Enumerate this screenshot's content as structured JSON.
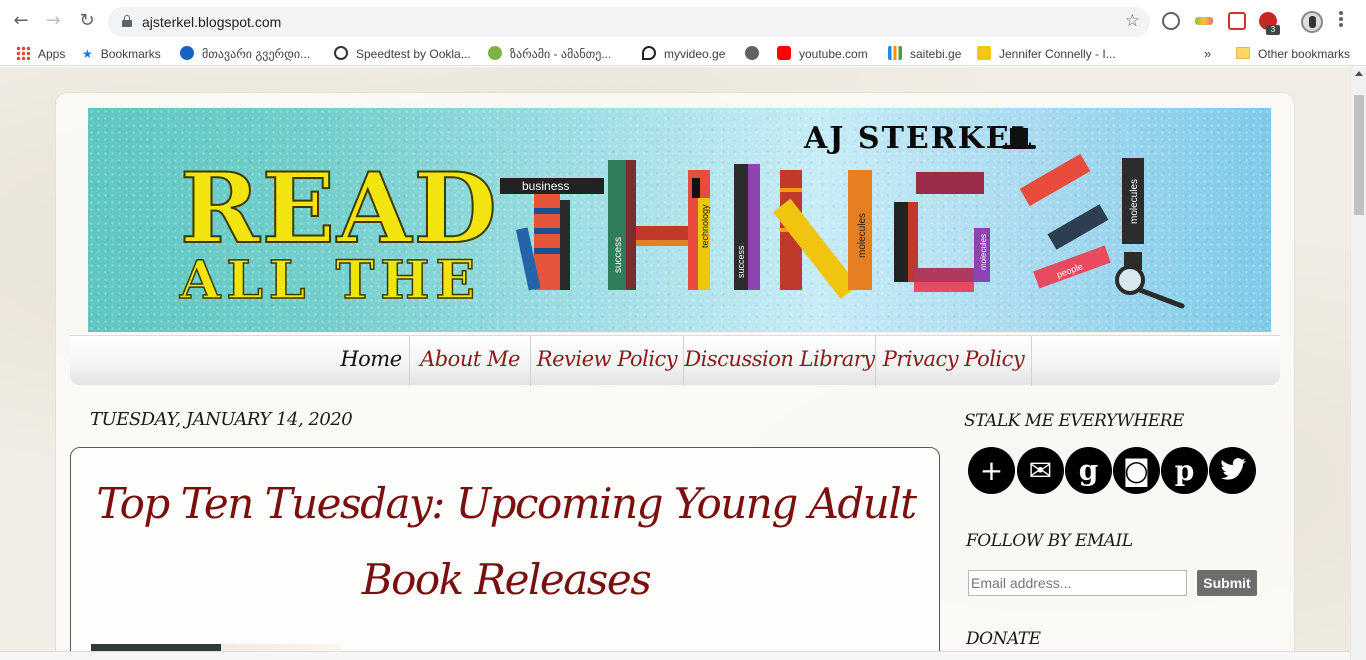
{
  "browser": {
    "url": "ajsterkel.blogspot.com",
    "extension_badge": "3",
    "bookmarks": [
      {
        "label": "Apps",
        "icon": "apps-grid-icon"
      },
      {
        "label": "Bookmarks",
        "icon": "star-icon"
      },
      {
        "label": "მთავარი გვერდი...",
        "icon": "net-icon"
      },
      {
        "label": "Speedtest by Ookla...",
        "icon": "speedtest-icon"
      },
      {
        "label": "ზარამი - ამანთე...",
        "icon": "globe-icon"
      },
      {
        "label": "myvideo.ge",
        "icon": "myvideo-icon"
      },
      {
        "label": "",
        "icon": "world-icon"
      },
      {
        "label": "youtube.com",
        "icon": "youtube-icon"
      },
      {
        "label": "saitebi.ge",
        "icon": "saitebi-icon"
      },
      {
        "label": "Jennifer Connelly - I...",
        "icon": "imdb-icon"
      }
    ],
    "overflow_chevron": "»",
    "other_bookmarks": "Other bookmarks"
  },
  "banner": {
    "author": "AJ STERKEL",
    "line1": "READ",
    "line2": "ALL THE",
    "word": "THINGS!",
    "book_labels": [
      "business",
      "success",
      "technology",
      "success",
      "molecules",
      "molecules",
      "people",
      "molecules"
    ]
  },
  "nav": {
    "tabs": [
      "Home",
      "About Me",
      "Review Policy",
      "Discussion Library",
      "Privacy Policy"
    ]
  },
  "post": {
    "date": "TUESDAY, JANUARY 14, 2020",
    "title_line1": "Top Ten Tuesday: Upcoming Young Adult",
    "title_line2": "Book Releases"
  },
  "sidebar": {
    "stalk_title": "STALK ME EVERYWHERE",
    "social_icons": [
      "plus-icon",
      "email-icon",
      "goodreads-icon",
      "instagram-icon",
      "pinterest-icon",
      "twitter-icon"
    ],
    "social_glyphs": [
      "+",
      "✉",
      "g",
      "◙",
      "p",
      "🐦"
    ],
    "follow_title": "FOLLOW BY EMAIL",
    "email_placeholder": "Email address...",
    "submit_label": "Submit",
    "donate_title": "DONATE"
  },
  "colors": {
    "nav_text": "#8b1a1a",
    "title_text": "#7a0f0f",
    "banner_teal": "#5fc7c2"
  }
}
